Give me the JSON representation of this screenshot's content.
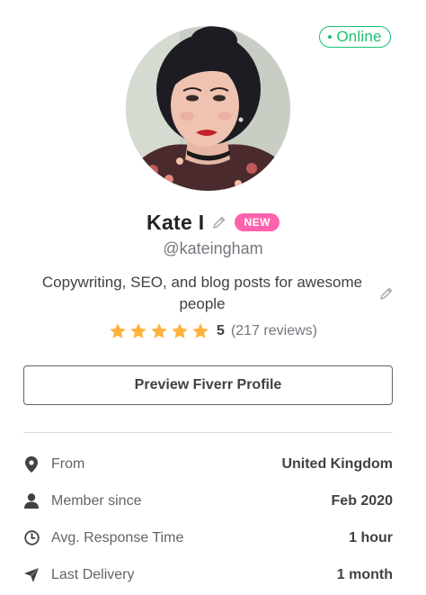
{
  "status": {
    "online_label": "Online",
    "color": "#1dbf73"
  },
  "profile": {
    "name": "Kate I",
    "badge": "NEW",
    "badge_color": "#ff62ad",
    "username": "@kateingham",
    "tagline": "Copywriting, SEO, and blog posts for awesome people",
    "avatar_icon": "profile-photo"
  },
  "rating": {
    "stars": 5,
    "max_stars": 5,
    "value": "5",
    "reviews": "(217 reviews)",
    "star_color": "#ffb33e"
  },
  "actions": {
    "preview_label": "Preview Fiverr Profile"
  },
  "stats": [
    {
      "icon": "location-pin-icon",
      "label": "From",
      "value": "United Kingdom"
    },
    {
      "icon": "user-icon",
      "label": "Member since",
      "value": "Feb 2020"
    },
    {
      "icon": "clock-icon",
      "label": "Avg. Response Time",
      "value": "1 hour"
    },
    {
      "icon": "paper-plane-icon",
      "label": "Last Delivery",
      "value": "1 month"
    }
  ]
}
